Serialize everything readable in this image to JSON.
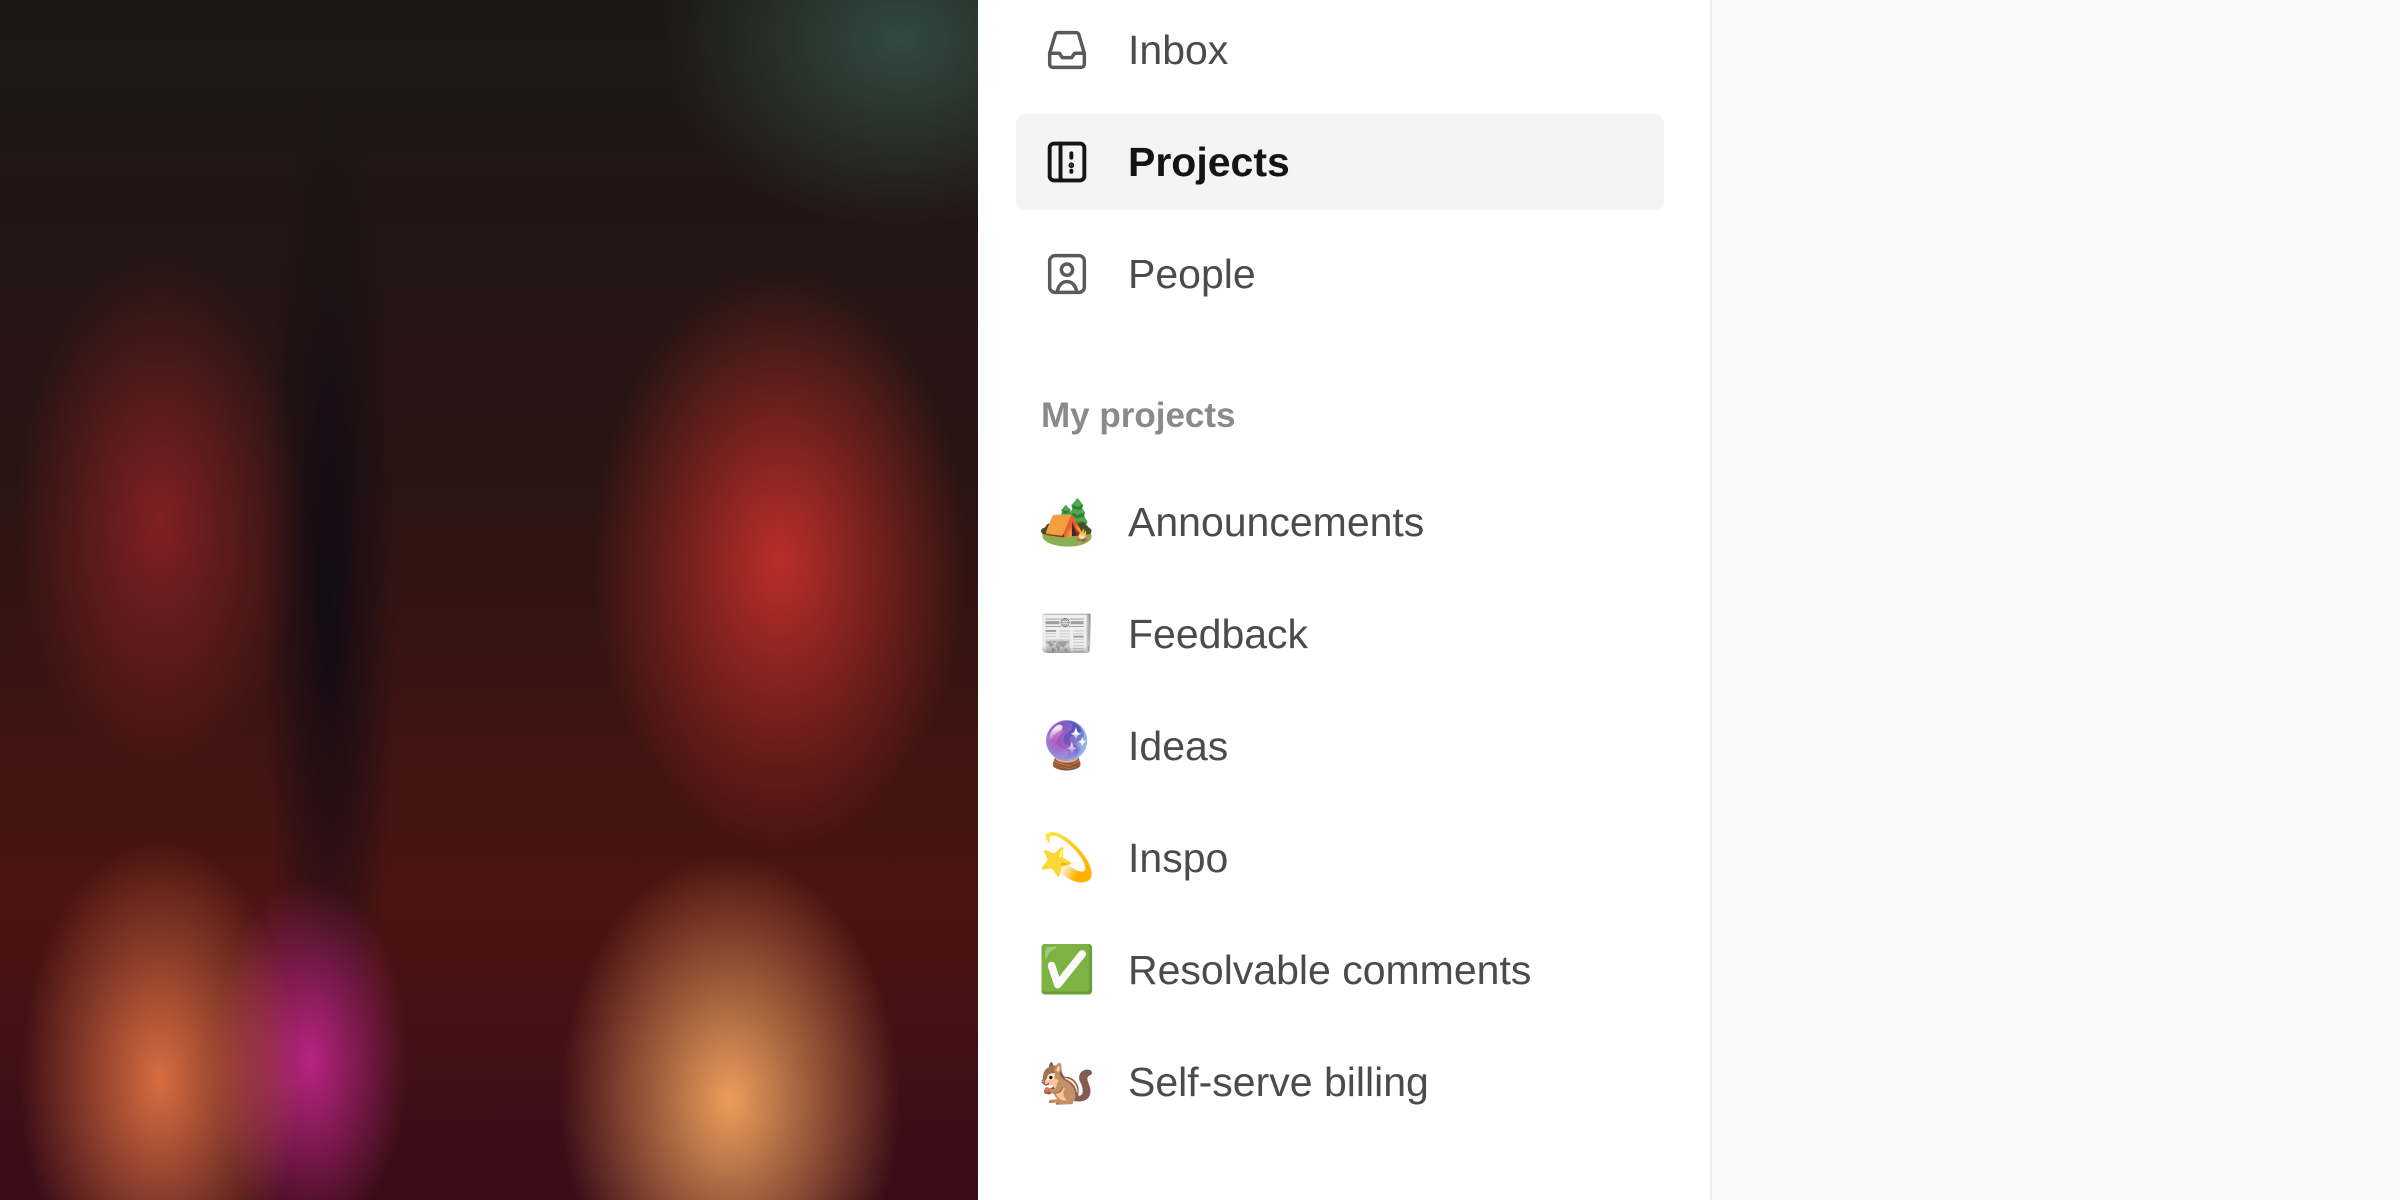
{
  "nav": {
    "items": [
      {
        "label": "Inbox",
        "icon": "inbox-icon"
      },
      {
        "label": "Projects",
        "icon": "projects-icon",
        "active": true
      },
      {
        "label": "People",
        "icon": "people-icon"
      }
    ]
  },
  "my_projects": {
    "title": "My projects",
    "items": [
      {
        "label": "Announcements",
        "emoji": "🏕️"
      },
      {
        "label": "Feedback",
        "emoji": "📰"
      },
      {
        "label": "Ideas",
        "emoji": "🔮"
      },
      {
        "label": "Inspo",
        "emoji": "💫"
      },
      {
        "label": "Resolvable comments",
        "emoji": "✅"
      },
      {
        "label": "Self-serve billing",
        "emoji": "🐿️"
      }
    ]
  },
  "colors": {
    "sidebar_bg": "#ffffff",
    "active_item_bg": "#f4f4f4",
    "text": "#4b4b4b",
    "active_text": "#141414",
    "section_title": "#8a8a8a"
  }
}
